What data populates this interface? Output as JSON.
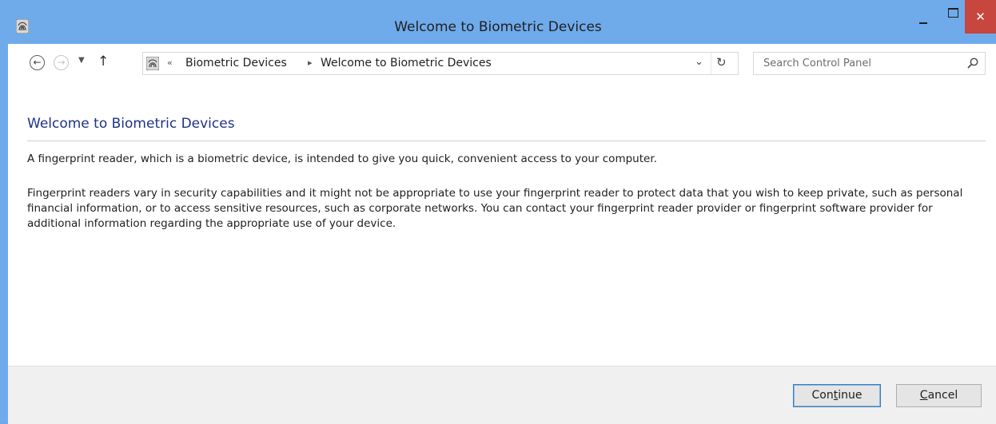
{
  "window": {
    "title": "Welcome to Biometric Devices",
    "close_glyph": "✕",
    "accent_color": "#6fabeb",
    "close_color": "#c7463d"
  },
  "navbar": {
    "back_glyph": "←",
    "forward_glyph": "→",
    "recent_glyph": "▼",
    "up_glyph": "↑",
    "address": {
      "overflow_glyph": "«",
      "crumbs": [
        "Biometric Devices",
        "Welcome to Biometric Devices"
      ],
      "separator_glyph": "▸",
      "dropdown_glyph": "⌄",
      "refresh_glyph": "↻"
    },
    "search": {
      "placeholder": "Search Control Panel"
    }
  },
  "content": {
    "heading": "Welcome to Biometric Devices",
    "paragraph_1": "A fingerprint reader, which is a biometric device, is intended to give you quick, convenient access to your computer.",
    "paragraph_2": "Fingerprint readers vary in security capabilities and it might not be appropriate to use your fingerprint reader to protect data that you wish to keep private, such as personal financial information, or to access sensitive resources, such as corporate networks. You can contact your fingerprint reader provider or fingerprint software provider for additional information regarding the appropriate use of your device."
  },
  "footer": {
    "continue_pre": "Con",
    "continue_mnemonic": "t",
    "continue_post": "inue",
    "cancel_mnemonic": "C",
    "cancel_post": "ancel"
  },
  "icons": [
    "fingerprint-icon",
    "back-arrow-icon",
    "forward-arrow-icon",
    "chevron-down-icon",
    "up-arrow-icon",
    "refresh-icon",
    "search-icon",
    "minimize-icon",
    "maximize-icon",
    "close-icon"
  ]
}
